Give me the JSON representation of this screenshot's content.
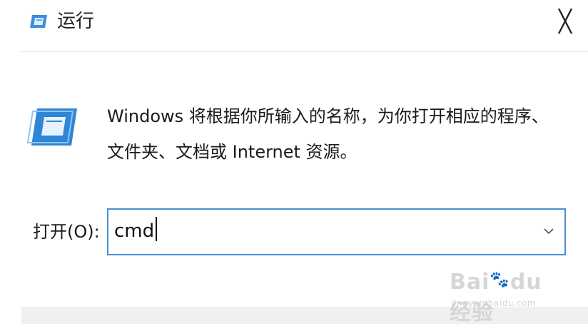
{
  "window": {
    "title": "运行",
    "close_glyph": "╳"
  },
  "icons": {
    "title_icon": "run-dialog-icon",
    "main_icon": "run-dialog-icon",
    "dropdown": "chevron-down-icon",
    "close": "close-icon"
  },
  "description": {
    "line1": "Windows 将根据你所输入的名称，为你打开相应的程序、",
    "line2": "文件夹、文档或 Internet 资源。"
  },
  "open_field": {
    "label": "打开(O):",
    "value": "cmd"
  },
  "watermark": {
    "logo_part1": "Bai",
    "logo_part2": "du",
    "logo_part3": "经验",
    "url": "jingyan.baidu.com"
  },
  "colors": {
    "accent_border": "#4a90d6",
    "icon_blue": "#3a8fd8",
    "footer": "#f0f0f0"
  }
}
